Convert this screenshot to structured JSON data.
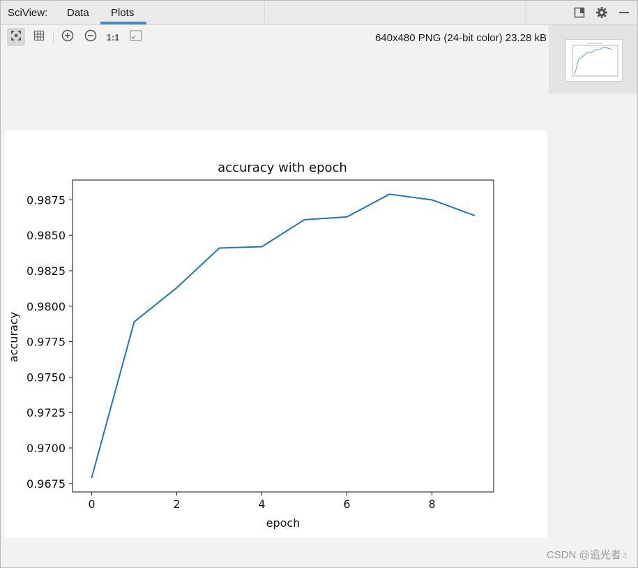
{
  "header": {
    "title": "SciView:",
    "tabs": [
      {
        "label": "Data"
      },
      {
        "label": "Plots"
      }
    ],
    "active_tab": "Plots"
  },
  "toolbar": {
    "buttons": [
      {
        "icon": "fit-screen-icon"
      },
      {
        "icon": "grid-icon"
      },
      {
        "icon": "zoom-in-icon"
      },
      {
        "icon": "zoom-out-icon"
      },
      {
        "label": "1:1"
      },
      {
        "icon": "fit-window-icon"
      }
    ],
    "image_info": "640x480 PNG (24-bit color) 23.28 kB"
  },
  "thumbnail": {
    "close_label": "×"
  },
  "chart_data": {
    "type": "line",
    "title": "accuracy with epoch",
    "xlabel": "epoch",
    "ylabel": "accuracy",
    "x": [
      0,
      1,
      2,
      3,
      4,
      5,
      6,
      7,
      8,
      9
    ],
    "series": [
      {
        "values": [
          0.9679,
          0.9789,
          0.9813,
          0.9841,
          0.9842,
          0.9861,
          0.9863,
          0.9879,
          0.9875,
          0.9864
        ],
        "color": "#1f77b4"
      }
    ],
    "xticks": [
      "0",
      "2",
      "4",
      "6",
      "8"
    ],
    "yticks": [
      "0.9675",
      "0.9700",
      "0.9725",
      "0.9750",
      "0.9775",
      "0.9800",
      "0.9825",
      "0.9850",
      "0.9875"
    ],
    "xlim": [
      -0.45,
      9.45
    ],
    "ylim": [
      0.9669,
      0.9889
    ],
    "grid": false,
    "legend": "none"
  },
  "footer": {
    "watermark": "CSDN @追光者♁"
  },
  "colors": {
    "accent": "#4a88c7",
    "line": "#1f77b4"
  }
}
